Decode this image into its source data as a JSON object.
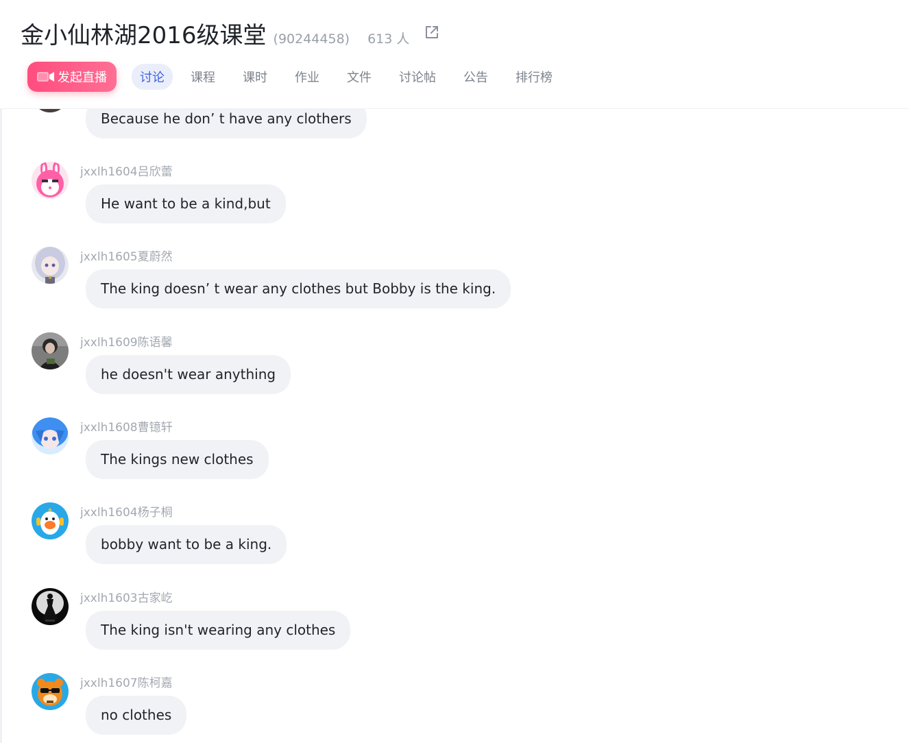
{
  "header": {
    "group_name": "金小仙林湖2016级课堂",
    "group_id": "(90244458)",
    "member_count": "613 人",
    "external_icon": "external-link-icon"
  },
  "tabs": {
    "live_button": "发起直播",
    "live_icon": "video-camera-icon",
    "items": [
      "讨论",
      "课程",
      "课时",
      "作业",
      "文件",
      "讨论帖",
      "公告",
      "排行榜"
    ],
    "active": "讨论"
  },
  "colors": {
    "accent": "#3f61e0",
    "live_button": "#ff4d7f",
    "bubble": "#f0f2f5",
    "sender_text": "#a3a8b0"
  },
  "messages": [
    {
      "sender": "",
      "text": "Because he don’ t have any clothers",
      "avatar": "user-avatar"
    },
    {
      "sender": "jxxlh1604吕欣蕾",
      "text": "He want to be a kind,but",
      "avatar": "pink-bunny-avatar"
    },
    {
      "sender": "jxxlh1605夏蔚然",
      "text": "The king doesn’ t wear any clothes but Bobby is the king.",
      "avatar": "anime-girl-avatar"
    },
    {
      "sender": "jxxlh1609陈语馨",
      "text": "he doesn't wear anything",
      "avatar": "photo-person-avatar"
    },
    {
      "sender": "jxxlh1608曹镱轩",
      "text": "The kings new clothes",
      "avatar": "blue-hair-anime-avatar"
    },
    {
      "sender": "jxxlh1604杨子桐",
      "text": "bobby want to be a king.",
      "avatar": "blue-penguin-avatar"
    },
    {
      "sender": "jxxlh1603古家屹",
      "text": "The king isn't wearing any clothes",
      "avatar": "black-dress-avatar"
    },
    {
      "sender": "jxxlh1607陈柯嘉",
      "text": "no clothes",
      "avatar": "tiger-sunglasses-avatar"
    }
  ]
}
